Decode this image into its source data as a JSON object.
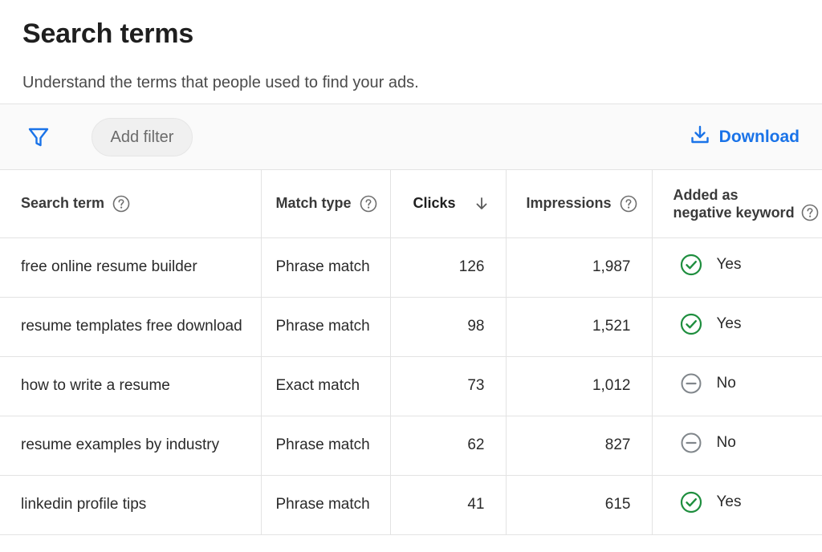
{
  "header": {
    "title": "Search terms",
    "subtitle": "Understand the terms that people used to find your ads."
  },
  "toolbar": {
    "filter_icon": "filter-icon",
    "add_filter_label": "Add filter",
    "download_label": "Download",
    "download_icon": "download-icon"
  },
  "table": {
    "columns": {
      "search_term": "Search term",
      "match_type": "Match type",
      "clicks": "Clicks",
      "impressions": "Impressions",
      "negative_line1": "Added as",
      "negative_line2": "negative keyword"
    },
    "sort": {
      "column": "Clicks",
      "direction": "descending",
      "icon": "arrow-down-icon"
    },
    "rows": [
      {
        "term": "free online resume builder",
        "match": "Phrase match",
        "clicks": "126",
        "impressions": "1,987",
        "negative": "Yes",
        "status_icon": "check-circle-icon"
      },
      {
        "term": "resume templates free download",
        "match": "Phrase match",
        "clicks": "98",
        "impressions": "1,521",
        "negative": "Yes",
        "status_icon": "check-circle-icon"
      },
      {
        "term": "how to write a resume",
        "match": "Exact match",
        "clicks": "73",
        "impressions": "1,012",
        "negative": "No",
        "status_icon": "minus-circle-icon"
      },
      {
        "term": "resume examples by industry",
        "match": "Phrase match",
        "clicks": "62",
        "impressions": "827",
        "negative": "No",
        "status_icon": "minus-circle-icon"
      },
      {
        "term": "linkedin profile tips",
        "match": "Phrase match",
        "clicks": "41",
        "impressions": "615",
        "negative": "Yes",
        "status_icon": "check-circle-icon"
      }
    ]
  },
  "colors": {
    "accent": "#1a73e8",
    "yes": "#1e8e3e",
    "no": "#80868b"
  }
}
